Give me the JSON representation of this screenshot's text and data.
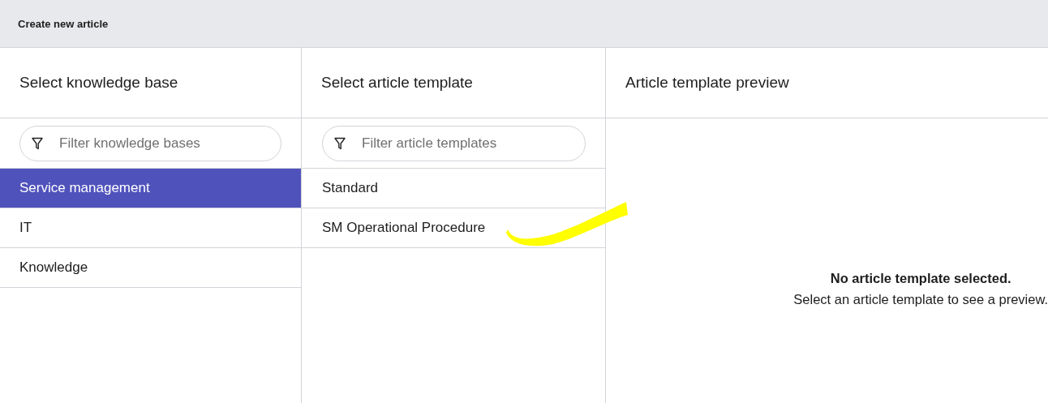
{
  "window": {
    "title": "Create new article"
  },
  "knowledge_bases": {
    "heading": "Select knowledge base",
    "filter": {
      "placeholder": "Filter knowledge bases"
    },
    "items": [
      {
        "label": "Service management",
        "selected": true
      },
      {
        "label": "IT",
        "selected": false
      },
      {
        "label": "Knowledge",
        "selected": false
      }
    ]
  },
  "templates": {
    "heading": "Select article template",
    "filter": {
      "placeholder": "Filter article templates"
    },
    "items": [
      {
        "label": "Standard",
        "selected": false
      },
      {
        "label": "SM Operational Procedure",
        "selected": false
      }
    ]
  },
  "preview": {
    "heading": "Article template preview",
    "empty_title": "No article template selected.",
    "empty_text": "Select an article template to see a preview."
  }
}
